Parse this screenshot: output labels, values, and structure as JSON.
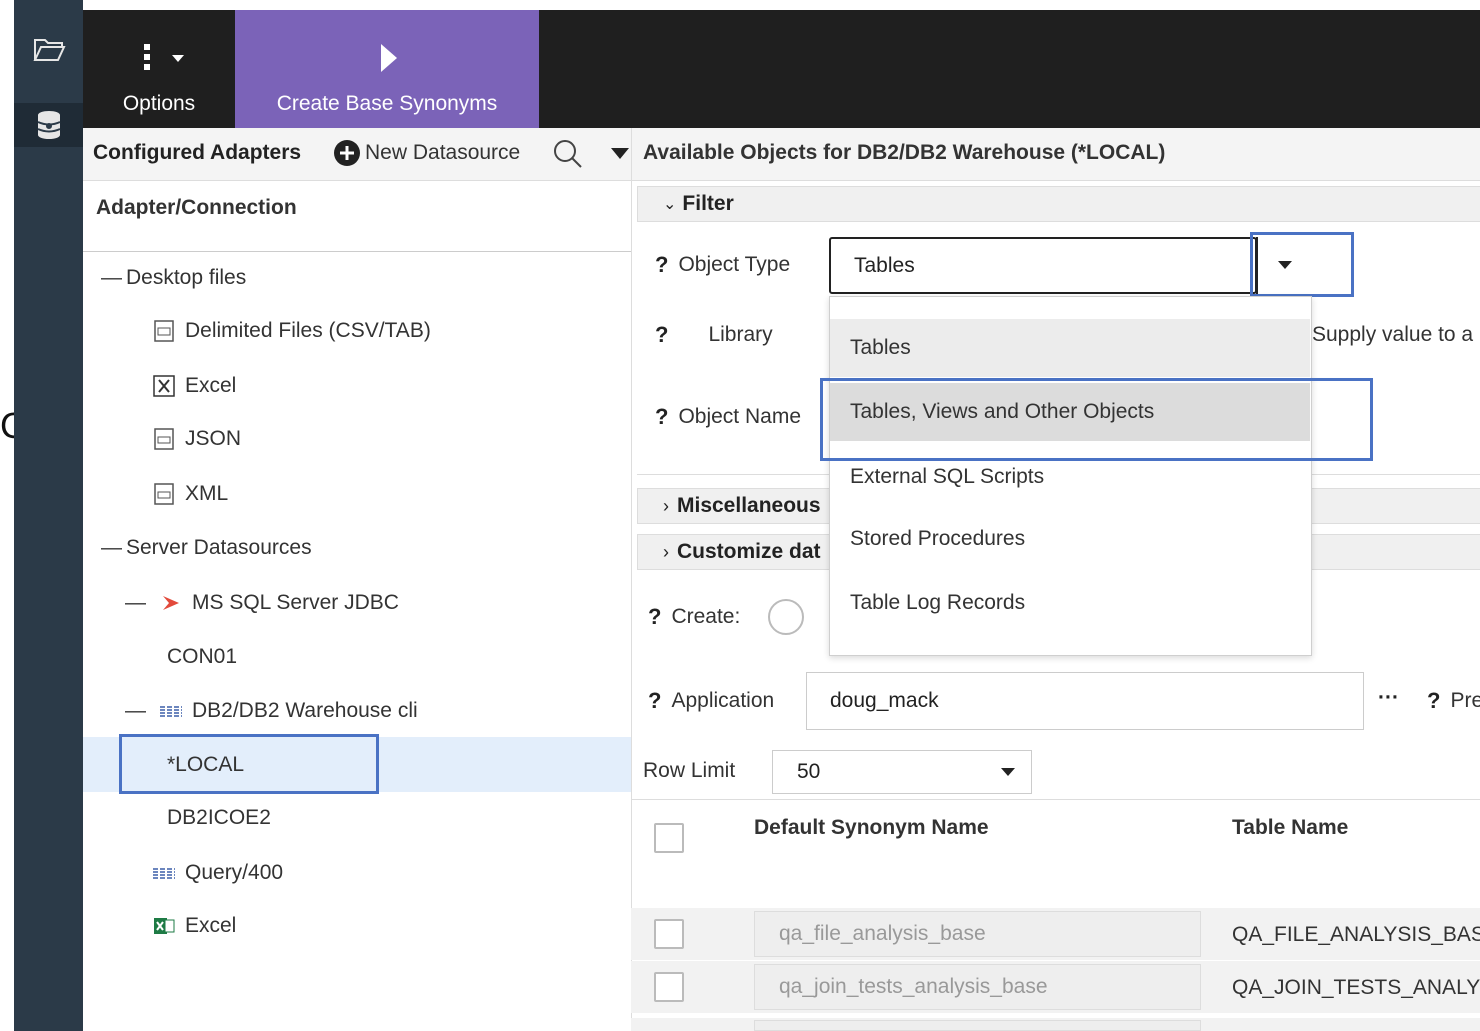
{
  "toolbar": {
    "options_label": "Options",
    "create_label": "Create Base Synonyms"
  },
  "left": {
    "header_title": "Configured Adapters",
    "new_datasource_label": "New Datasource",
    "column_header": "Adapter/Connection",
    "tree": {
      "desktop_files": "Desktop files",
      "delimited": "Delimited Files (CSV/TAB)",
      "excel": "Excel",
      "json": "JSON",
      "xml": "XML",
      "server_datasources": "Server Datasources",
      "mssql": "MS SQL Server JDBC",
      "con01": "CON01",
      "db2": "DB2/DB2 Warehouse cli",
      "local": "*LOCAL",
      "db2icoe2": "DB2ICOE2",
      "query400": "Query/400",
      "excel2": "Excel"
    }
  },
  "right": {
    "header_title": "Available Objects for DB2/DB2 Warehouse (*LOCAL)",
    "filter_label": "Filter",
    "object_type_label": "Object Type",
    "object_type_value": "Tables",
    "library_label": "Library",
    "supply_text": "Supply value to a",
    "object_name_label": "Object Name",
    "misc_label": "Miscellaneous",
    "customize_label": "Customize dat",
    "create_label": "Create:",
    "application_label": "Application",
    "application_value": "doug_mack",
    "ellipsis": "···",
    "pre_label": "Pre",
    "row_limit_label": "Row Limit",
    "row_limit_value": "50",
    "col_synonym": "Default Synonym Name",
    "col_table": "Table Name",
    "rows": [
      {
        "synonym": "qa_file_analysis_base",
        "table": "QA_FILE_ANALYSIS_BASE"
      },
      {
        "synonym": "qa_join_tests_analysis_base",
        "table": "QA_JOIN_TESTS_ANALYSIS"
      }
    ]
  },
  "dropdown": {
    "options": [
      "Tables",
      "Tables, Views and Other Objects",
      "External SQL Scripts",
      "Stored Procedures",
      "Table Log Records"
    ]
  },
  "misc": {
    "stray_char": "C"
  },
  "colors": {
    "accent": "#7b63b8",
    "highlight_box": "#4a72c4",
    "toolbar_bg": "#1f1f1f",
    "rail_bg": "#2b3a48"
  }
}
